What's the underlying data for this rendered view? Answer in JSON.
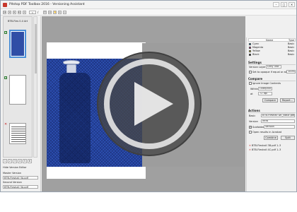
{
  "window": {
    "title": "Pitstop PDF Toolbox 2016 - Versioning Assistant",
    "buttons": {
      "minimize": "–",
      "maximize": "□",
      "close": "✕"
    }
  },
  "toolbar": {
    "page_value": "1",
    "page_sep": "/"
  },
  "sidebar": {
    "thumbs": [
      {
        "label": "BTB-Fles 0.4 Art"
      },
      {
        "label": ""
      },
      {
        "label": ""
      }
    ],
    "page_numbers": [
      "1",
      "2",
      "3",
      "4",
      "5",
      "6"
    ],
    "hide_label": "Hide Version Editor",
    "master_label": "Master Version",
    "master_value": "BTB-Fleshall 3A.pdf",
    "second_label": "Second Version",
    "second_value": "BTB-Fleshall 3A.pdf"
  },
  "right_panel": {
    "layers": {
      "head_name": "Name",
      "head_type": "Type",
      "items": [
        {
          "name": "Cyan",
          "type": "Basic",
          "color": "#18a9e6"
        },
        {
          "name": "Magenta",
          "type": "Basic",
          "color": "#e01e8a"
        },
        {
          "name": "Yellow",
          "type": "Basic",
          "color": "#f2e20f"
        },
        {
          "name": "Black",
          "type": "Basic",
          "color": "#111111"
        }
      ]
    },
    "settings": {
      "title": "Settings",
      "version_layer_label": "Version Layer:",
      "version_layer_value": "Dirty Text",
      "opacity_label": "Set to opaque if equal or above",
      "opacity_value": "100%"
    },
    "compare": {
      "title": "Compare",
      "ignore_label": "Ignore Image Contents",
      "within_label": "Within",
      "within_value": "Overprint",
      "at_label": "at",
      "at_value": "72 dpi",
      "compare_btn": "Compare",
      "report_btn": "Report..."
    },
    "actions": {
      "title": "Actions",
      "basic_label": "Basic",
      "basic_value": "BTB-Fleshall DK_Basic.pdf",
      "version_label": "Version",
      "version_value": "Intro",
      "subfolder_label": "Subfolder",
      "subfolder_value": "Version",
      "open_label": "Open results in Acrobat",
      "combine_btn": "Combine",
      "split_btn": "Split",
      "files": [
        "BTB-Fleshall 3B.pdf   1–3",
        "BTB-Fleshall 4C.pdf   1–3"
      ]
    }
  },
  "colors": {
    "accent": "#4a8fd7",
    "artwork_blue": "#2c4fb0",
    "play_overlay": "#4c4c4c"
  },
  "overlay": {
    "icon": "play-icon"
  }
}
